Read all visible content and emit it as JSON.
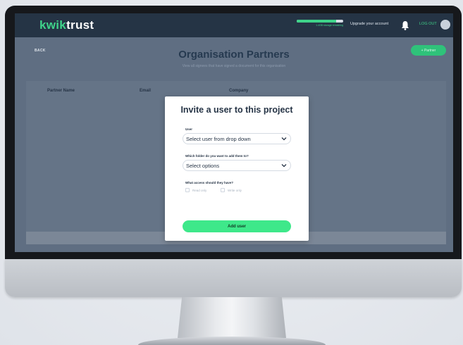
{
  "brand": {
    "part1": "kwik",
    "part2": "trust",
    "accent": "#3fd38a"
  },
  "header": {
    "storage_label": "1.4GB storage remaining",
    "storage_percent": 85,
    "upgrade_label": "Upgrade your account",
    "bell_icon": "bell-icon",
    "logout_label": "LOG OUT"
  },
  "page": {
    "back_label": "BACK",
    "title": "Organisation Partners",
    "subtitle": "View all signees that have signed a document for this organisation",
    "add_partner_label": "+ Partner"
  },
  "table": {
    "columns": [
      "Partner Name",
      "Email",
      "Company"
    ]
  },
  "modal": {
    "title": "Invite a user to this project",
    "user_label": "User",
    "user_value": "Select user from drop down",
    "folder_label": "Which folder do you want to add them to?",
    "folder_value": "Select options",
    "access_label": "What access should they have?",
    "access_options": [
      "Read only",
      "Write only"
    ],
    "submit_label": "Add user"
  }
}
